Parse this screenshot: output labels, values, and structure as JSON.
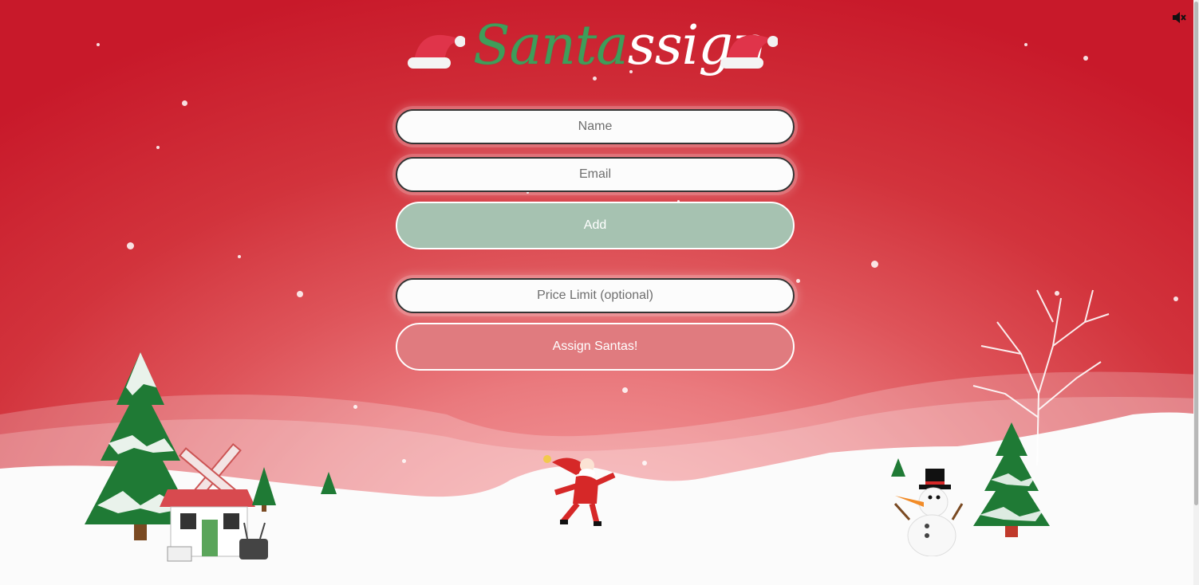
{
  "app": {
    "logo_part1": "Santa",
    "logo_part2": "ssign"
  },
  "audio": {
    "icon": "speaker-muted-icon"
  },
  "form": {
    "name_placeholder": "Name",
    "email_placeholder": "Email",
    "add_label": "Add",
    "price_placeholder": "Price Limit (optional)",
    "assign_label": "Assign Santas!"
  },
  "colors": {
    "background_top": "#c8192a",
    "background_glow": "#f7a5a7",
    "logo_green": "#3f9d5a",
    "add_button": "#a6c2b1",
    "assign_button": "#e07b7f",
    "snow": "#ffffff"
  },
  "scene": {
    "decorations": [
      "santa-hat-icon",
      "christmas-tree-icon",
      "windmill-house-icon",
      "dancing-santa-icon",
      "snowman-icon",
      "bare-snowy-tree-icon",
      "snowflake-icon"
    ]
  }
}
